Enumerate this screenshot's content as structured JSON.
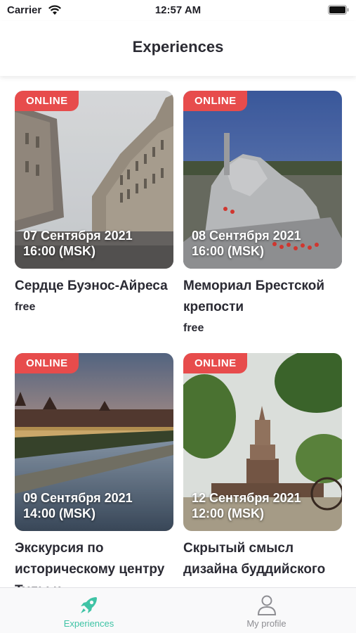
{
  "status_bar": {
    "carrier": "Carrier",
    "time": "12:57 AM"
  },
  "header": {
    "title": "Experiences"
  },
  "experiences": [
    {
      "badge": "ONLINE",
      "date": "07 Сентября 2021",
      "time": "16:00 (MSK)",
      "title": "Сердце Буэнос-Айреса",
      "price": "free"
    },
    {
      "badge": "ONLINE",
      "date": "08 Сентября 2021",
      "time": "16:00 (MSK)",
      "title": "Мемориал Брестской крепости",
      "price": "free"
    },
    {
      "badge": "ONLINE",
      "date": "09 Сентября 2021",
      "time": "14:00 (MSK)",
      "title": "Экскурсия по историческому центру Тулы и",
      "price": ""
    },
    {
      "badge": "ONLINE",
      "date": "12 Сентября 2021",
      "time": "12:00 (MSK)",
      "title": "Скрытый смысл дизайна буддийского",
      "price": ""
    }
  ],
  "tabs": [
    {
      "label": "Experiences",
      "icon": "rocket-icon",
      "active": true
    },
    {
      "label": "My profile",
      "icon": "person-icon",
      "active": false
    }
  ],
  "colors": {
    "badge": "#e74c4c",
    "active_tab": "#3fc3a5",
    "inactive_tab": "#8e8e93"
  }
}
